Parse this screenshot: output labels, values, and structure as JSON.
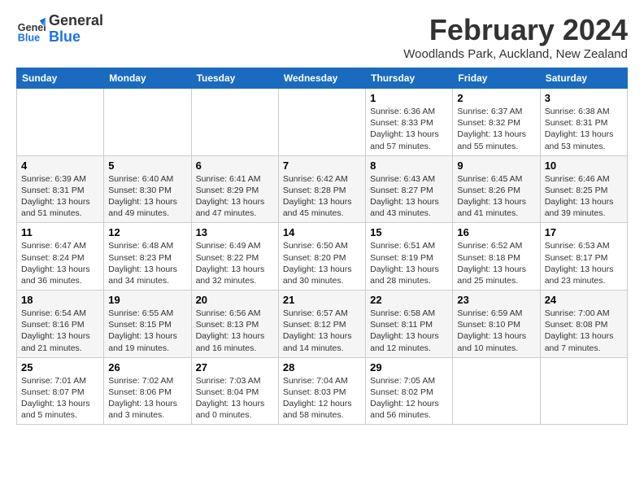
{
  "header": {
    "logo_general": "General",
    "logo_blue": "Blue",
    "month_title": "February 2024",
    "location": "Woodlands Park, Auckland, New Zealand"
  },
  "weekdays": [
    "Sunday",
    "Monday",
    "Tuesday",
    "Wednesday",
    "Thursday",
    "Friday",
    "Saturday"
  ],
  "weeks": [
    [
      {
        "day": "",
        "info": ""
      },
      {
        "day": "",
        "info": ""
      },
      {
        "day": "",
        "info": ""
      },
      {
        "day": "",
        "info": ""
      },
      {
        "day": "1",
        "info": "Sunrise: 6:36 AM\nSunset: 8:33 PM\nDaylight: 13 hours\nand 57 minutes."
      },
      {
        "day": "2",
        "info": "Sunrise: 6:37 AM\nSunset: 8:32 PM\nDaylight: 13 hours\nand 55 minutes."
      },
      {
        "day": "3",
        "info": "Sunrise: 6:38 AM\nSunset: 8:31 PM\nDaylight: 13 hours\nand 53 minutes."
      }
    ],
    [
      {
        "day": "4",
        "info": "Sunrise: 6:39 AM\nSunset: 8:31 PM\nDaylight: 13 hours\nand 51 minutes."
      },
      {
        "day": "5",
        "info": "Sunrise: 6:40 AM\nSunset: 8:30 PM\nDaylight: 13 hours\nand 49 minutes."
      },
      {
        "day": "6",
        "info": "Sunrise: 6:41 AM\nSunset: 8:29 PM\nDaylight: 13 hours\nand 47 minutes."
      },
      {
        "day": "7",
        "info": "Sunrise: 6:42 AM\nSunset: 8:28 PM\nDaylight: 13 hours\nand 45 minutes."
      },
      {
        "day": "8",
        "info": "Sunrise: 6:43 AM\nSunset: 8:27 PM\nDaylight: 13 hours\nand 43 minutes."
      },
      {
        "day": "9",
        "info": "Sunrise: 6:45 AM\nSunset: 8:26 PM\nDaylight: 13 hours\nand 41 minutes."
      },
      {
        "day": "10",
        "info": "Sunrise: 6:46 AM\nSunset: 8:25 PM\nDaylight: 13 hours\nand 39 minutes."
      }
    ],
    [
      {
        "day": "11",
        "info": "Sunrise: 6:47 AM\nSunset: 8:24 PM\nDaylight: 13 hours\nand 36 minutes."
      },
      {
        "day": "12",
        "info": "Sunrise: 6:48 AM\nSunset: 8:23 PM\nDaylight: 13 hours\nand 34 minutes."
      },
      {
        "day": "13",
        "info": "Sunrise: 6:49 AM\nSunset: 8:22 PM\nDaylight: 13 hours\nand 32 minutes."
      },
      {
        "day": "14",
        "info": "Sunrise: 6:50 AM\nSunset: 8:20 PM\nDaylight: 13 hours\nand 30 minutes."
      },
      {
        "day": "15",
        "info": "Sunrise: 6:51 AM\nSunset: 8:19 PM\nDaylight: 13 hours\nand 28 minutes."
      },
      {
        "day": "16",
        "info": "Sunrise: 6:52 AM\nSunset: 8:18 PM\nDaylight: 13 hours\nand 25 minutes."
      },
      {
        "day": "17",
        "info": "Sunrise: 6:53 AM\nSunset: 8:17 PM\nDaylight: 13 hours\nand 23 minutes."
      }
    ],
    [
      {
        "day": "18",
        "info": "Sunrise: 6:54 AM\nSunset: 8:16 PM\nDaylight: 13 hours\nand 21 minutes."
      },
      {
        "day": "19",
        "info": "Sunrise: 6:55 AM\nSunset: 8:15 PM\nDaylight: 13 hours\nand 19 minutes."
      },
      {
        "day": "20",
        "info": "Sunrise: 6:56 AM\nSunset: 8:13 PM\nDaylight: 13 hours\nand 16 minutes."
      },
      {
        "day": "21",
        "info": "Sunrise: 6:57 AM\nSunset: 8:12 PM\nDaylight: 13 hours\nand 14 minutes."
      },
      {
        "day": "22",
        "info": "Sunrise: 6:58 AM\nSunset: 8:11 PM\nDaylight: 13 hours\nand 12 minutes."
      },
      {
        "day": "23",
        "info": "Sunrise: 6:59 AM\nSunset: 8:10 PM\nDaylight: 13 hours\nand 10 minutes."
      },
      {
        "day": "24",
        "info": "Sunrise: 7:00 AM\nSunset: 8:08 PM\nDaylight: 13 hours\nand 7 minutes."
      }
    ],
    [
      {
        "day": "25",
        "info": "Sunrise: 7:01 AM\nSunset: 8:07 PM\nDaylight: 13 hours\nand 5 minutes."
      },
      {
        "day": "26",
        "info": "Sunrise: 7:02 AM\nSunset: 8:06 PM\nDaylight: 13 hours\nand 3 minutes."
      },
      {
        "day": "27",
        "info": "Sunrise: 7:03 AM\nSunset: 8:04 PM\nDaylight: 13 hours\nand 0 minutes."
      },
      {
        "day": "28",
        "info": "Sunrise: 7:04 AM\nSunset: 8:03 PM\nDaylight: 12 hours\nand 58 minutes."
      },
      {
        "day": "29",
        "info": "Sunrise: 7:05 AM\nSunset: 8:02 PM\nDaylight: 12 hours\nand 56 minutes."
      },
      {
        "day": "",
        "info": ""
      },
      {
        "day": "",
        "info": ""
      }
    ]
  ]
}
